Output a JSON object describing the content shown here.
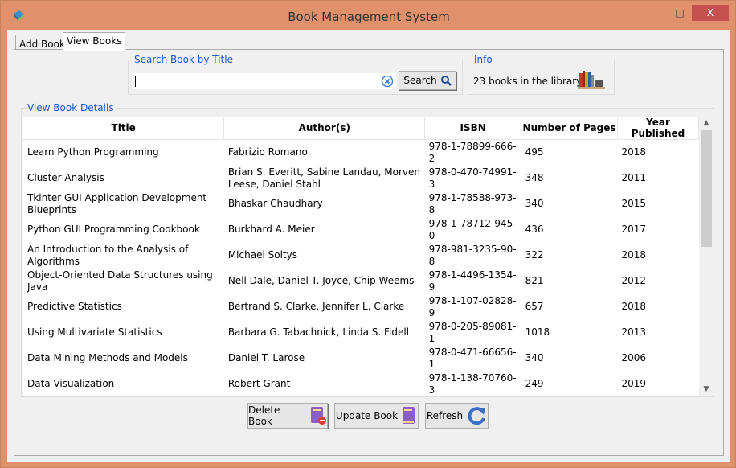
{
  "window": {
    "title": "Book Management System",
    "minimize": "_",
    "maximize": "□",
    "close": "X"
  },
  "tabs": [
    {
      "label": "Add Book",
      "active": false
    },
    {
      "label": "View Books",
      "active": true
    }
  ],
  "search": {
    "legend": "Search Book by Title",
    "value": "",
    "placeholder": "",
    "button_label": "Search"
  },
  "info": {
    "legend": "Info",
    "text": "23 books in the library"
  },
  "details": {
    "legend": "View Book Details"
  },
  "table": {
    "columns": [
      "Title",
      "Author(s)",
      "ISBN",
      "Number of Pages",
      "Year Published"
    ],
    "rows": [
      [
        "Learn Python Programming",
        "Fabrizio Romano",
        "978-1-78899-666-2",
        "495",
        "2018"
      ],
      [
        "Cluster Analysis",
        "Brian S. Everitt, Sabine Landau, Morven Leese, Daniel Stahl",
        "978-0-470-74991-3",
        "348",
        "2011"
      ],
      [
        "Tkinter GUI Application Development Blueprints",
        "Bhaskar Chaudhary",
        "978-1-78588-973-8",
        "340",
        "2015"
      ],
      [
        "Python GUI Programming Cookbook",
        "Burkhard A. Meier",
        "978-1-78712-945-0",
        "436",
        "2017"
      ],
      [
        "An Introduction to the Analysis of Algorithms",
        "Michael Soltys",
        "978-981-3235-90-8",
        "322",
        "2018"
      ],
      [
        "Object-Oriented Data Structures using Java",
        "Nell Dale, Daniel T. Joyce, Chip Weems",
        "978-1-4496-1354-9",
        "821",
        "2012"
      ],
      [
        "Predictive Statistics",
        "Bertrand S. Clarke, Jennifer L. Clarke",
        "978-1-107-02828-9",
        "657",
        "2018"
      ],
      [
        "Using Multivariate Statistics",
        "Barbara G. Tabachnick, Linda S. Fidell",
        "978-0-205-89081-1",
        "1018",
        "2013"
      ],
      [
        "Data Mining Methods and Models",
        "Daniel T. Larose",
        "978-0-471-66656-1",
        "340",
        "2006"
      ],
      [
        "Data Visualization",
        "Robert Grant",
        "978-1-138-70760-3",
        "249",
        "2019"
      ]
    ]
  },
  "buttons": {
    "delete": "Delete Book",
    "update": "Update Book",
    "refresh": "Refresh"
  },
  "colors": {
    "titlebar": "#E0916B",
    "close": "#C75050",
    "legend": "#1a56db",
    "book_icon": "#8a5fc9"
  }
}
